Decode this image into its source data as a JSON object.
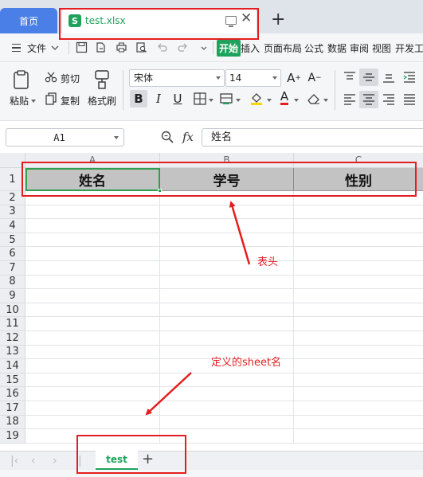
{
  "tabs": {
    "home": "首页",
    "file": "test.xlsx",
    "file_icon": "S"
  },
  "menu": {
    "file": "文件",
    "items": [
      "开始",
      "插入",
      "页面布局",
      "公式",
      "数据",
      "审阅",
      "视图",
      "开发工"
    ],
    "active_index": 0
  },
  "ribbon": {
    "paste": "粘贴",
    "cut": "剪切",
    "copy": "复制",
    "format_painter": "格式刷",
    "font_name": "宋体",
    "font_size": "14"
  },
  "formula_bar": {
    "cell_ref": "A1",
    "fx": "fx",
    "value": "姓名"
  },
  "grid": {
    "columns": [
      "A",
      "B",
      "C"
    ],
    "rows": [
      "1",
      "2",
      "3",
      "4",
      "5",
      "6",
      "7",
      "8",
      "9",
      "10",
      "11",
      "12",
      "13",
      "14",
      "15",
      "16",
      "17",
      "18",
      "19"
    ],
    "header_row": [
      "姓名",
      "学号",
      "性别"
    ]
  },
  "sheets": {
    "active": "test"
  },
  "annotations": {
    "header_label": "表头",
    "sheet_label": "定义的sheet名"
  },
  "colors": {
    "accent": "#1fa35c",
    "home_tab": "#4a7fe8",
    "annotation": "#e41e20",
    "header_fill": "#c3c3c3"
  }
}
